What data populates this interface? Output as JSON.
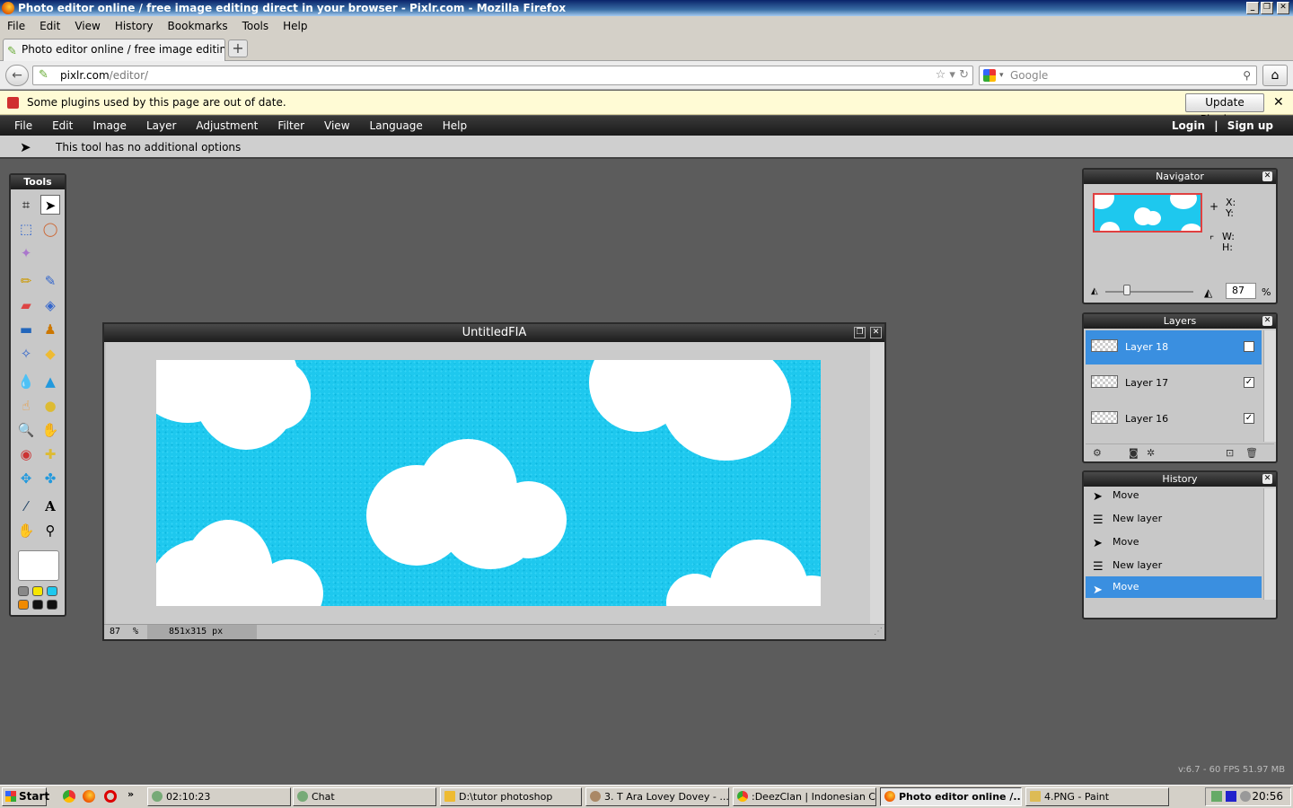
{
  "window": {
    "title": "Photo editor online / free image editing direct in your browser - Pixlr.com - Mozilla Firefox"
  },
  "browser_menu": [
    "File",
    "Edit",
    "View",
    "History",
    "Bookmarks",
    "Tools",
    "Help"
  ],
  "tab": {
    "label": "Photo editor online / free image editing direct i..."
  },
  "url": {
    "domain": "pixlr.com",
    "path": "/editor/"
  },
  "search": {
    "placeholder": "Google"
  },
  "plugin_bar": {
    "message": "Some plugins used by this page are out of date.",
    "button": "Update Plugins..."
  },
  "pixlr_menu": [
    "File",
    "Edit",
    "Image",
    "Layer",
    "Adjustment",
    "Filter",
    "View",
    "Language",
    "Help"
  ],
  "account": {
    "login": "Login",
    "separator": "|",
    "signup": "Sign up"
  },
  "options_bar": {
    "text": "This tool has no additional options"
  },
  "tools_panel": {
    "title": "Tools"
  },
  "document": {
    "title": "UntitledFIA",
    "zoom": "87",
    "zoom_unit": "%",
    "size": "851x315 px"
  },
  "navigator": {
    "title": "Navigator",
    "x_label": "X:",
    "y_label": "Y:",
    "w_label": "W:",
    "h_label": "H:",
    "zoom_value": "87",
    "zoom_unit": "%"
  },
  "layers": {
    "title": "Layers",
    "items": [
      {
        "name": "Layer 18",
        "selected": true,
        "visible": true
      },
      {
        "name": "Layer 17",
        "selected": false,
        "visible": true
      },
      {
        "name": "Layer 16",
        "selected": false,
        "visible": true
      }
    ]
  },
  "history": {
    "title": "History",
    "items": [
      {
        "label": "Move",
        "icon": "move-icon"
      },
      {
        "label": "New layer",
        "icon": "new-layer-icon"
      },
      {
        "label": "Move",
        "icon": "move-icon"
      },
      {
        "label": "New layer",
        "icon": "new-layer-icon"
      },
      {
        "label": "Move",
        "icon": "move-icon",
        "selected": true
      }
    ]
  },
  "version": "v:6.7 - 60 FPS 51.97 MB",
  "taskbar": {
    "start": "Start",
    "more": "»",
    "items": [
      {
        "label": "02:10:23"
      },
      {
        "label": "Chat"
      },
      {
        "label": "D:\\tutor photoshop"
      },
      {
        "label": "3. T Ara Lovey Dovey - ..."
      },
      {
        "label": ":DeezClan | Indonesian Cr..."
      },
      {
        "label": "Photo editor online /...",
        "active": true
      },
      {
        "label": "4.PNG - Paint"
      }
    ],
    "clock": "20:56"
  },
  "colors": {
    "accent": "#3a8fe0",
    "sky": "#1ec8ee",
    "panel_header": "#2a2a2a"
  }
}
